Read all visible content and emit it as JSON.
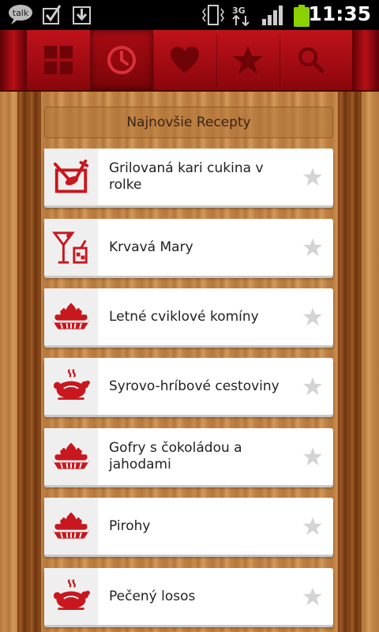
{
  "status_bar": {
    "time": "11:35",
    "icons": [
      "talk-icon",
      "checkbox-icon",
      "download-icon",
      "vibrate-icon",
      "3g-icon",
      "signal-icon",
      "battery-icon"
    ],
    "talk_label": "talk",
    "network_label": "3G"
  },
  "tabs": [
    {
      "name": "grid-icon",
      "active": false
    },
    {
      "name": "clock-icon",
      "active": true
    },
    {
      "name": "heart-icon",
      "active": false
    },
    {
      "name": "star-icon",
      "active": false
    },
    {
      "name": "search-icon",
      "active": false
    }
  ],
  "section": {
    "title": "Najnovšie Recepty"
  },
  "recipes": [
    {
      "name": "Grilovaná kari cukina v rolke",
      "icon": "grill-icon"
    },
    {
      "name": "Krvavá Mary",
      "icon": "cocktail-icon"
    },
    {
      "name": "Letné cviklové komíny",
      "icon": "pie-icon"
    },
    {
      "name": "Syrovo-hríbové cestoviny",
      "icon": "roast-chicken-icon"
    },
    {
      "name": "Gofry s čokoládou a jahodami",
      "icon": "pie-icon"
    },
    {
      "name": "Pirohy",
      "icon": "pie-icon"
    },
    {
      "name": "Pečený losos",
      "icon": "roast-chicken-icon"
    }
  ],
  "colors": {
    "accent": "#c8171e",
    "tab_bar": "#a80c13",
    "star": "#d4d4d4"
  }
}
